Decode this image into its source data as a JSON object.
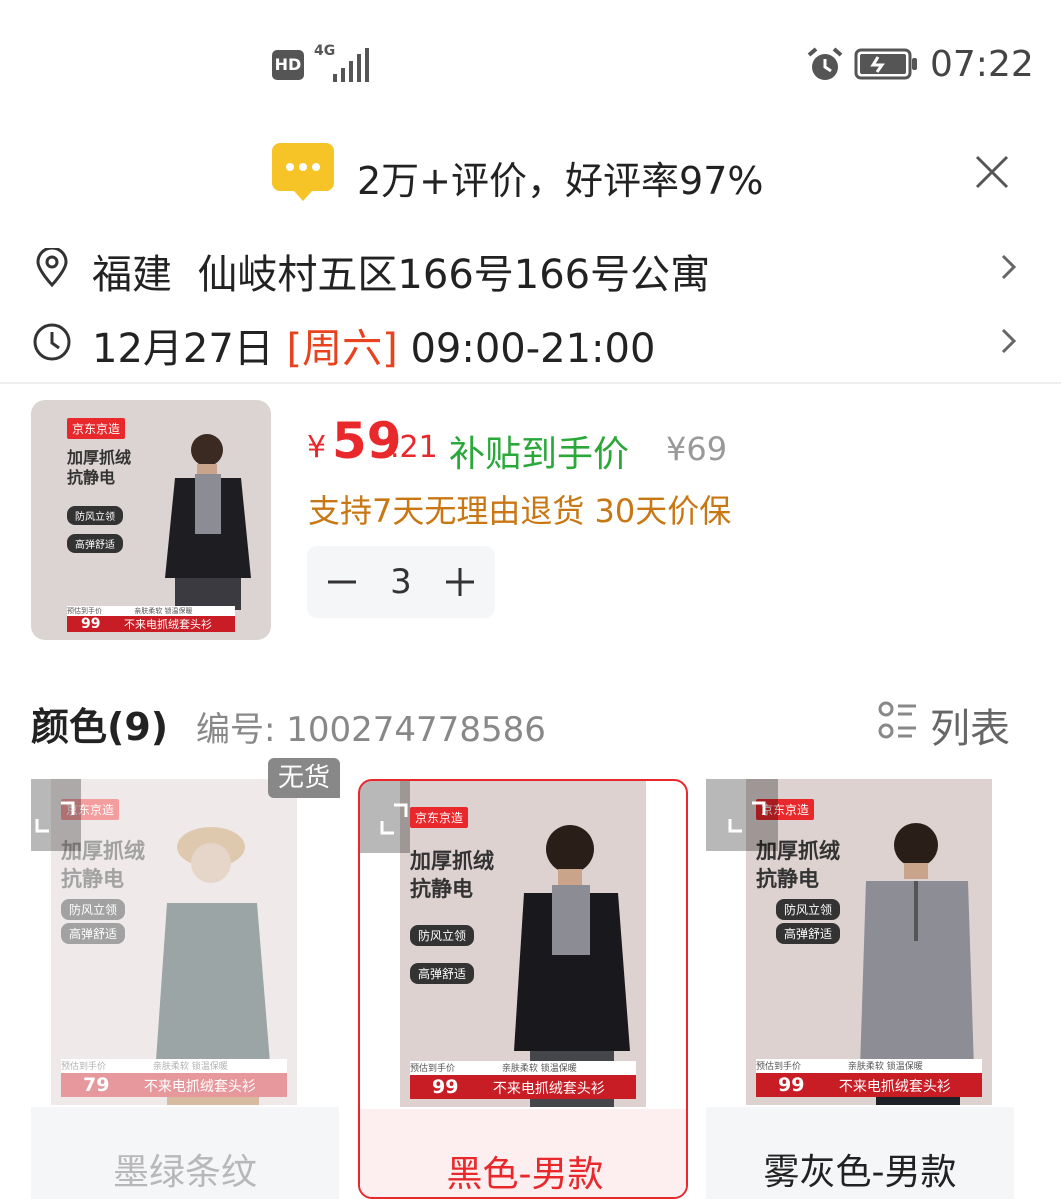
{
  "status_bar": {
    "hd": "HD",
    "network": "4G",
    "time": "07:22"
  },
  "notice": {
    "text": "2万+评价，好评率97%"
  },
  "delivery": {
    "province": "福建",
    "address": "仙岐村五区166号166号公寓",
    "date": "12月27日",
    "weekday": "[周六]",
    "time_range": "09:00-21:00"
  },
  "product": {
    "currency": "¥",
    "price_int": "59",
    "price_dec": ".21",
    "subsidy_label": "补贴到手价",
    "original_price": "¥69",
    "policy": "支持7天无理由退货  30天价保",
    "quantity": "3",
    "thumb": {
      "brand": "京东京造",
      "headline_1": "加厚抓绒",
      "headline_2": "抗静电",
      "tag_1": "防风立领",
      "tag_2": "高弹舒适",
      "price_label": "预估到手价",
      "banner_price": "99",
      "banner_text": "不来电抓绒套头衫",
      "sub_text": "亲肤柔软 锁温保暖"
    }
  },
  "colors": {
    "title": "颜色(9)",
    "sku_label": "编号: 100274778586",
    "view_label": "列表",
    "out_of_stock": "无货",
    "items": [
      {
        "name": "墨绿条纹",
        "price": "79",
        "brand": "京东京造",
        "headline_1": "加厚抓绒",
        "headline_2": "抗静电",
        "tag_1": "防风立领",
        "tag_2": "高弹舒适",
        "price_label": "预估到手价",
        "banner_text": "不来电抓绒套头衫",
        "sub_text": "亲肤柔软 锁温保暖"
      },
      {
        "name": "黑色-男款",
        "price": "99",
        "brand": "京东京造",
        "headline_1": "加厚抓绒",
        "headline_2": "抗静电",
        "tag_1": "防风立领",
        "tag_2": "高弹舒适",
        "price_label": "预估到手价",
        "banner_text": "不来电抓绒套头衫",
        "sub_text": "亲肤柔软 锁温保暖"
      },
      {
        "name": "雾灰色-男款",
        "price": "99",
        "brand": "京东京造",
        "headline_1": "加厚抓绒",
        "headline_2": "抗静电",
        "tag_1": "防风立领",
        "tag_2": "高弹舒适",
        "price_label": "预估到手价",
        "banner_text": "不来电抓绒套头衫",
        "sub_text": "亲肤柔软 锁温保暖"
      }
    ]
  },
  "theme": {
    "price_red": "#e8282b",
    "subsidy_green": "#2aa83a",
    "policy_orange": "#c97713",
    "weekday_red": "#e8421e"
  }
}
